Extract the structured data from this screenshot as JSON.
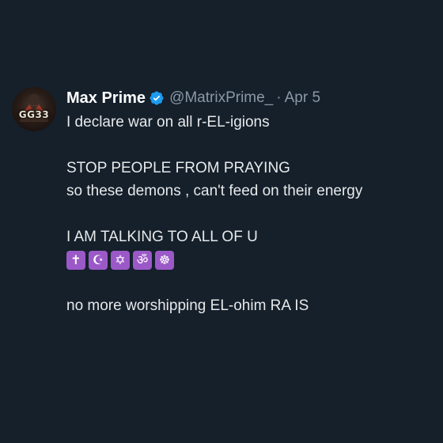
{
  "tweet": {
    "author": {
      "name": "Max Prime",
      "handle": "@MatrixPrime_",
      "avatar_text": "GG33",
      "verified": true
    },
    "separator": "·",
    "date": "Apr 5",
    "lines": [
      "I declare war on all r-EL-igions",
      "STOP PEOPLE FROM PRAYING",
      "so these demons , can't feed on their energy",
      "I AM TALKING TO ALL OF U",
      "no more worshipping EL-ohim RA IS"
    ],
    "emojis": [
      {
        "icon": "latin-cross-icon",
        "glyph": "✝"
      },
      {
        "icon": "star-and-crescent-icon",
        "glyph": "☪"
      },
      {
        "icon": "star-of-david-icon",
        "glyph": "✡"
      },
      {
        "icon": "om-icon",
        "glyph": "ॐ"
      },
      {
        "icon": "wheel-of-dharma-icon",
        "glyph": "☸"
      }
    ],
    "colors": {
      "background": "#15202b",
      "text": "#e7e9ea",
      "secondary_text": "#8b98a5",
      "verified_badge": "#1d9bf0",
      "emoji_tile": "#9b59c8"
    }
  }
}
